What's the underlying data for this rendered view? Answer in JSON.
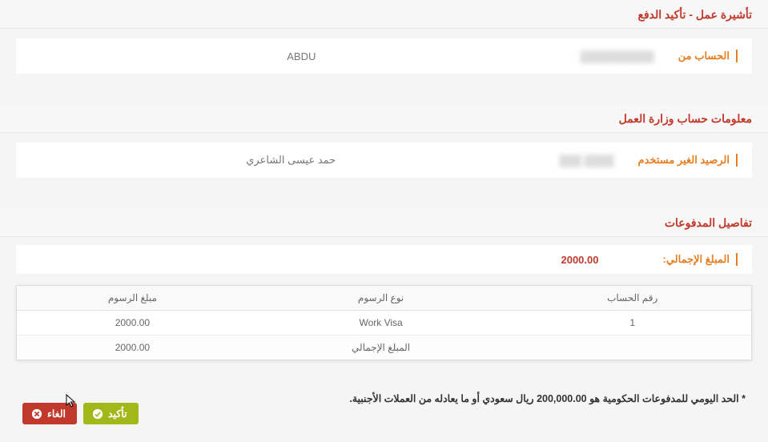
{
  "section1": {
    "title": "تأشيرة عمل - تأكيد الدفع",
    "account_from_label": "الحساب من",
    "account_from_value": "ABDU"
  },
  "section2": {
    "title": "معلومات حساب وزارة العمل",
    "unused_balance_label": "الرصيد الغير مستخدم",
    "unused_balance_value": "حمد عيسى الشاعري"
  },
  "section3": {
    "title": "تفاصيل المدفوعات",
    "total_label": "المبلغ الإجمالي:",
    "total_value": "2000.00"
  },
  "table": {
    "headers": {
      "account_no": "رقم الحساب",
      "fee_type": "نوع الرسوم",
      "fee_amount": "مبلغ الرسوم"
    },
    "row": {
      "account_no": "1",
      "fee_type": "Work Visa",
      "fee_amount": "2000.00"
    },
    "footer": {
      "label": "المبلغ الإجمالي",
      "value": "2000.00"
    }
  },
  "note": "* الحد اليومي للمدفوعات الحكومية هو 200,000.00 ريال سعودي أو ما يعادله من العملات الأجنبية.",
  "buttons": {
    "confirm": "تأكيد",
    "cancel": "الغاء"
  }
}
